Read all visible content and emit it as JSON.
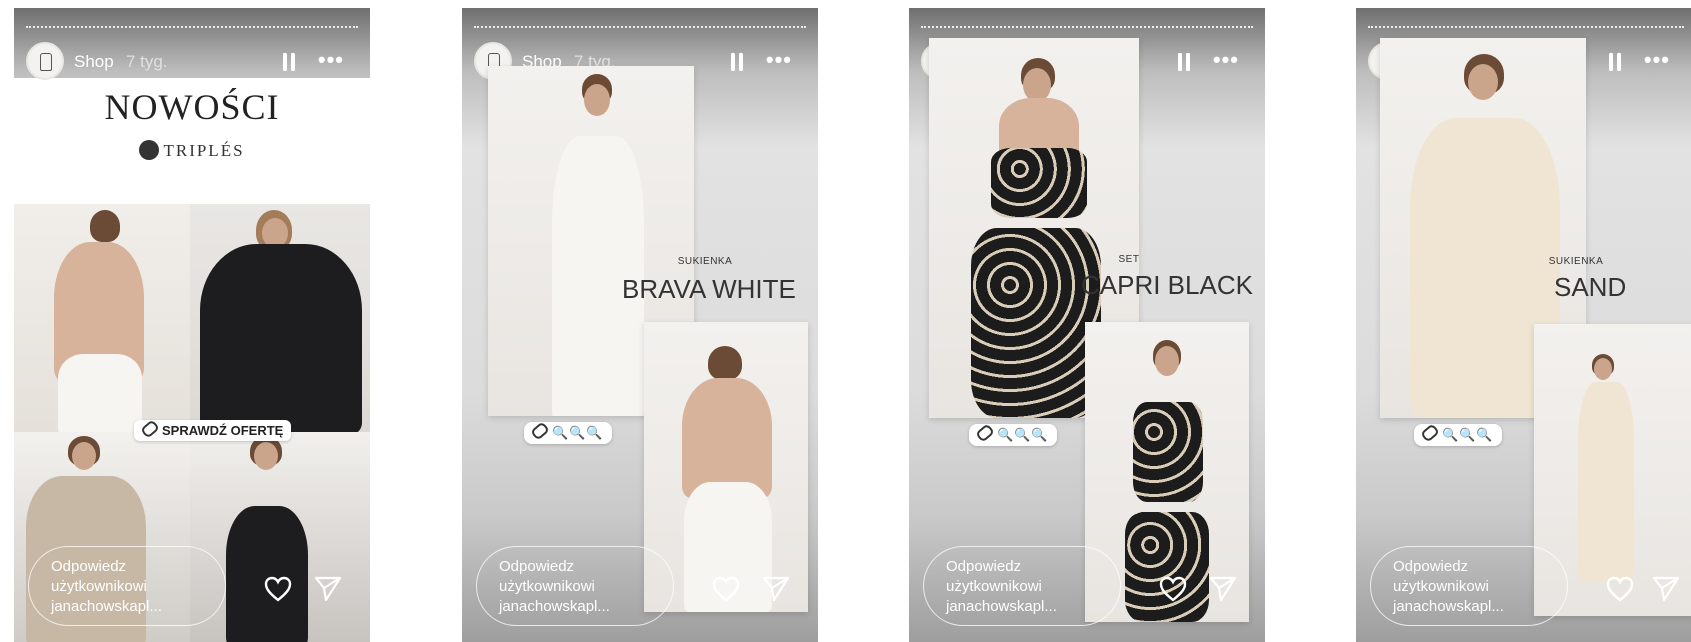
{
  "story_header": {
    "shop": "Shop",
    "time": "7 tyg."
  },
  "story1": {
    "title": "NOWOŚCI",
    "brand": "TRIPLÉS",
    "cta": "SPRAWDŹ OFERTĘ"
  },
  "story2": {
    "small": "SUKIENKA",
    "big": "BRAVA WHITE",
    "sticker": "🔍🔍🔍"
  },
  "story3": {
    "small": "SET",
    "big": "CAPRI BLACK",
    "sticker": "🔍🔍🔍"
  },
  "story4": {
    "small": "SUKIENKA",
    "big": "SAND",
    "sticker": "🔍🔍🔍"
  },
  "reply": {
    "line1": "Odpowiedz",
    "line2": "użytkownikowi",
    "line3": "janachowskapl..."
  },
  "icons": [
    "pause-icon",
    "more-icon",
    "heart-icon",
    "send-icon",
    "link-icon",
    "search-icon"
  ]
}
